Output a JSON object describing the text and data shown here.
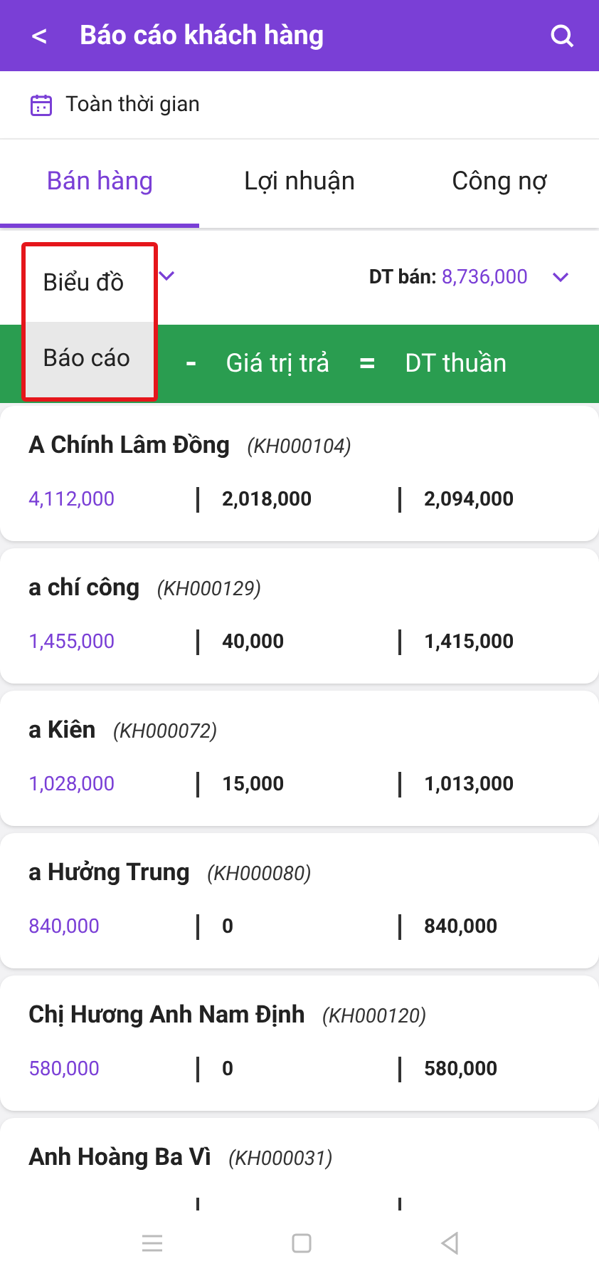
{
  "header": {
    "back": "<",
    "title": "Báo cáo khách hàng"
  },
  "date_filter": {
    "label": "Toàn thời gian"
  },
  "tabs": [
    {
      "label": "Bán hàng",
      "selected": true
    },
    {
      "label": "Lợi nhuận",
      "selected": false
    },
    {
      "label": "Công nợ",
      "selected": false
    }
  ],
  "summary": {
    "label": "DT bán:",
    "value": "8,736,000"
  },
  "formula_bar": {
    "items": [
      {
        "kind": "operator",
        "text": "-"
      },
      {
        "kind": "label",
        "text": "Giá trị trả"
      },
      {
        "kind": "operator",
        "text": "="
      },
      {
        "kind": "label",
        "text": "DT thuần"
      }
    ]
  },
  "view_menu": {
    "items": [
      {
        "label": "Biểu đồ",
        "selected": false
      },
      {
        "label": "Báo cáo",
        "selected": true
      }
    ]
  },
  "customers": [
    {
      "name": "A Chính Lâm Đồng",
      "code": "(KH000104)",
      "sales": "4,112,000",
      "returns": "2,018,000",
      "net": "2,094,000"
    },
    {
      "name": "a chí công",
      "code": "(KH000129)",
      "sales": "1,455,000",
      "returns": "40,000",
      "net": "1,415,000"
    },
    {
      "name": "a Kiên",
      "code": "(KH000072)",
      "sales": "1,028,000",
      "returns": "15,000",
      "net": "1,013,000"
    },
    {
      "name": "a Hưởng Trung",
      "code": "(KH000080)",
      "sales": "840,000",
      "returns": "0",
      "net": "840,000"
    },
    {
      "name": "Chị Hương Anh Nam Định",
      "code": "(KH000120)",
      "sales": "580,000",
      "returns": "0",
      "net": "580,000"
    },
    {
      "name": "Anh Hoàng Ba Vì",
      "code": "(KH000031)"
    }
  ]
}
